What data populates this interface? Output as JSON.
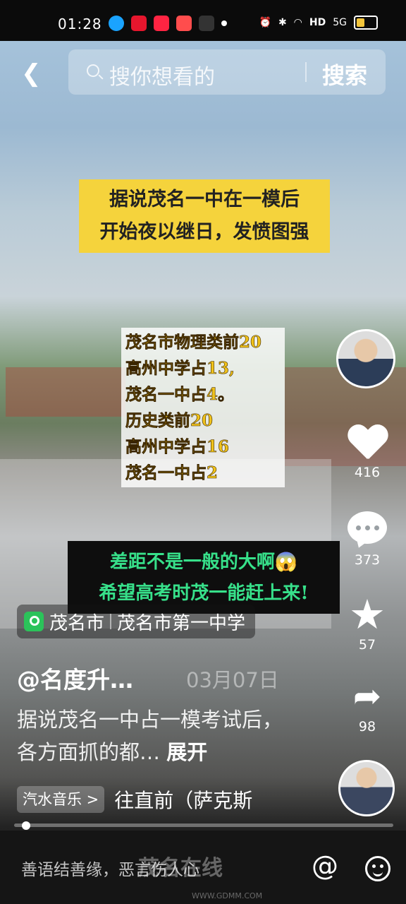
{
  "status_bar": {
    "time": "01:28",
    "network": "5G"
  },
  "search": {
    "placeholder": "搜你想看的",
    "button": "搜索"
  },
  "video": {
    "caption_top": [
      "据说茂名一中在一模后",
      "开始夜以继日，发愤图强"
    ],
    "caption_mid": [
      "茂名市物理类前20",
      "高州中学占13,",
      "茂名一中占4。",
      "历史类前20",
      "高州中学占16",
      "茂名一中占2"
    ],
    "caption_bottom": [
      "差距不是一般的大啊😱",
      "希望高考时茂一能赶上来!"
    ],
    "location": {
      "city": "茂名市",
      "place": "茂名市第一中学"
    },
    "author": "@名度升…",
    "date": "03月07日",
    "description": "据说茂名一中占一模考试后，各方面抓的都…",
    "expand": "展开",
    "music_tag": "汽水音乐 >",
    "music_name": "往直前（萨克斯",
    "progress": 0.02
  },
  "rail": {
    "likes": "416",
    "comments": "373",
    "favorites": "57",
    "shares": "98"
  },
  "comment_bar": {
    "placeholder": "善语结善缘，恶言伤人心",
    "at": "@"
  },
  "watermark": {
    "name": "茂名在线",
    "url": "WWW.GDMM.COM"
  }
}
